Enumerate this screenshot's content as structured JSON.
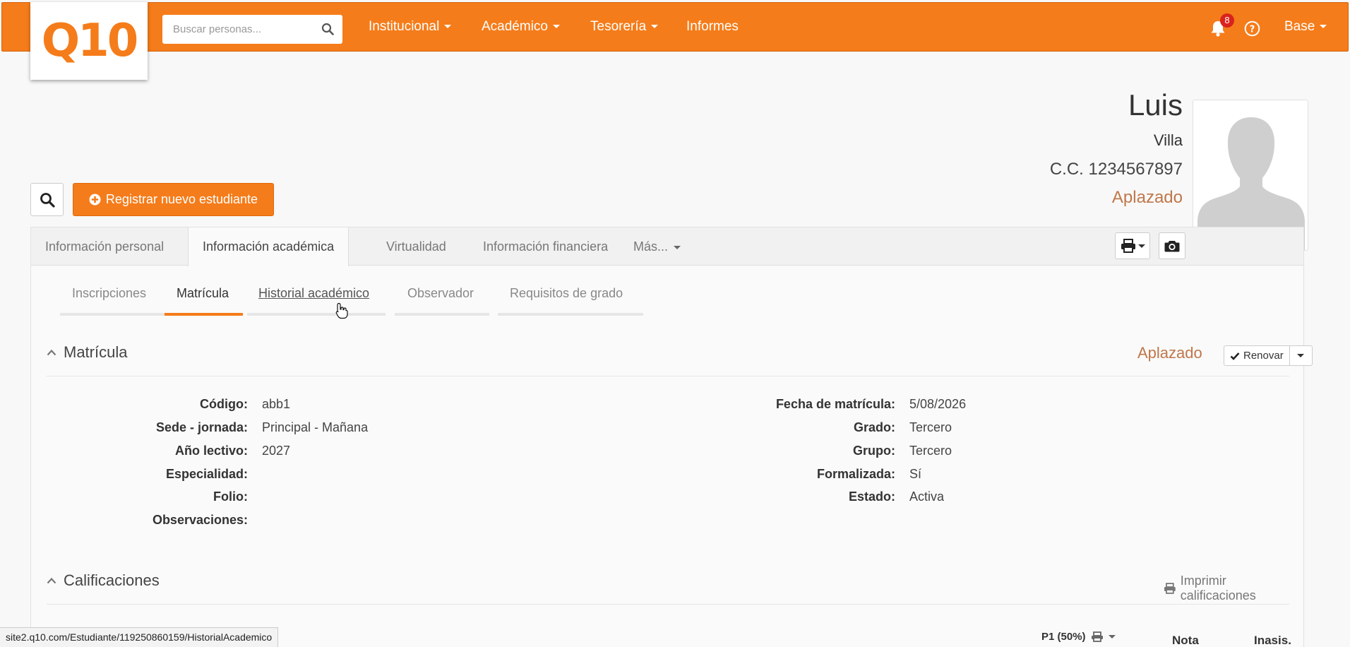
{
  "app": {
    "logo_text": "Q10",
    "brand_color": "#f57c1a"
  },
  "search": {
    "placeholder": "Buscar personas..."
  },
  "nav": {
    "items": [
      {
        "label": "Institucional",
        "dropdown": true
      },
      {
        "label": "Académico",
        "dropdown": true
      },
      {
        "label": "Tesorería",
        "dropdown": true
      },
      {
        "label": "Informes",
        "dropdown": false
      }
    ],
    "notifications_count": "8",
    "user_label": "Base"
  },
  "profile": {
    "first_name": "Luis",
    "last_name": "Villa",
    "document": "C.C. 1234567897",
    "status": "Aplazado",
    "status_color": "#c0774a"
  },
  "actions": {
    "register_label": "Registrar nuevo estudiante"
  },
  "tabs": [
    {
      "label": "Información personal",
      "active": false
    },
    {
      "label": "Información académica",
      "active": true
    },
    {
      "label": "Virtualidad",
      "active": false
    },
    {
      "label": "Información financiera",
      "active": false
    },
    {
      "label": "Más...",
      "active": false,
      "dropdown": true
    }
  ],
  "subtabs": [
    {
      "label": "Inscripciones",
      "active": false
    },
    {
      "label": "Matrícula",
      "active": true
    },
    {
      "label": "Historial académico",
      "active": false,
      "hovered": true
    },
    {
      "label": "Observador",
      "active": false
    },
    {
      "label": "Requisitos de grado",
      "active": false
    }
  ],
  "enrollment": {
    "title": "Matrícula",
    "status": "Aplazado",
    "renew_label": "Renovar",
    "left_fields": [
      {
        "label": "Código:",
        "value": "abb1"
      },
      {
        "label": "Sede - jornada:",
        "value": "Principal - Mañana"
      },
      {
        "label": "Año lectivo:",
        "value": "2027"
      },
      {
        "label": "Especialidad:",
        "value": ""
      },
      {
        "label": "Folio:",
        "value": ""
      },
      {
        "label": "Observaciones:",
        "value": ""
      }
    ],
    "right_fields": [
      {
        "label": "Fecha de matrícula:",
        "value": "5/08/2026"
      },
      {
        "label": "Grado:",
        "value": "Tercero"
      },
      {
        "label": "Grupo:",
        "value": "Tercero"
      },
      {
        "label": "Formalizada:",
        "value": "Sí"
      },
      {
        "label": "Estado:",
        "value": "Activa"
      }
    ]
  },
  "grades": {
    "title": "Calificaciones",
    "print_label": "Imprimir calificaciones",
    "period_column": "P1 (50%)",
    "columns": [
      "Nota",
      "Inasis."
    ]
  },
  "statusbar": {
    "url": "site2.q10.com/Estudiante/119250860159/HistorialAcademico"
  }
}
